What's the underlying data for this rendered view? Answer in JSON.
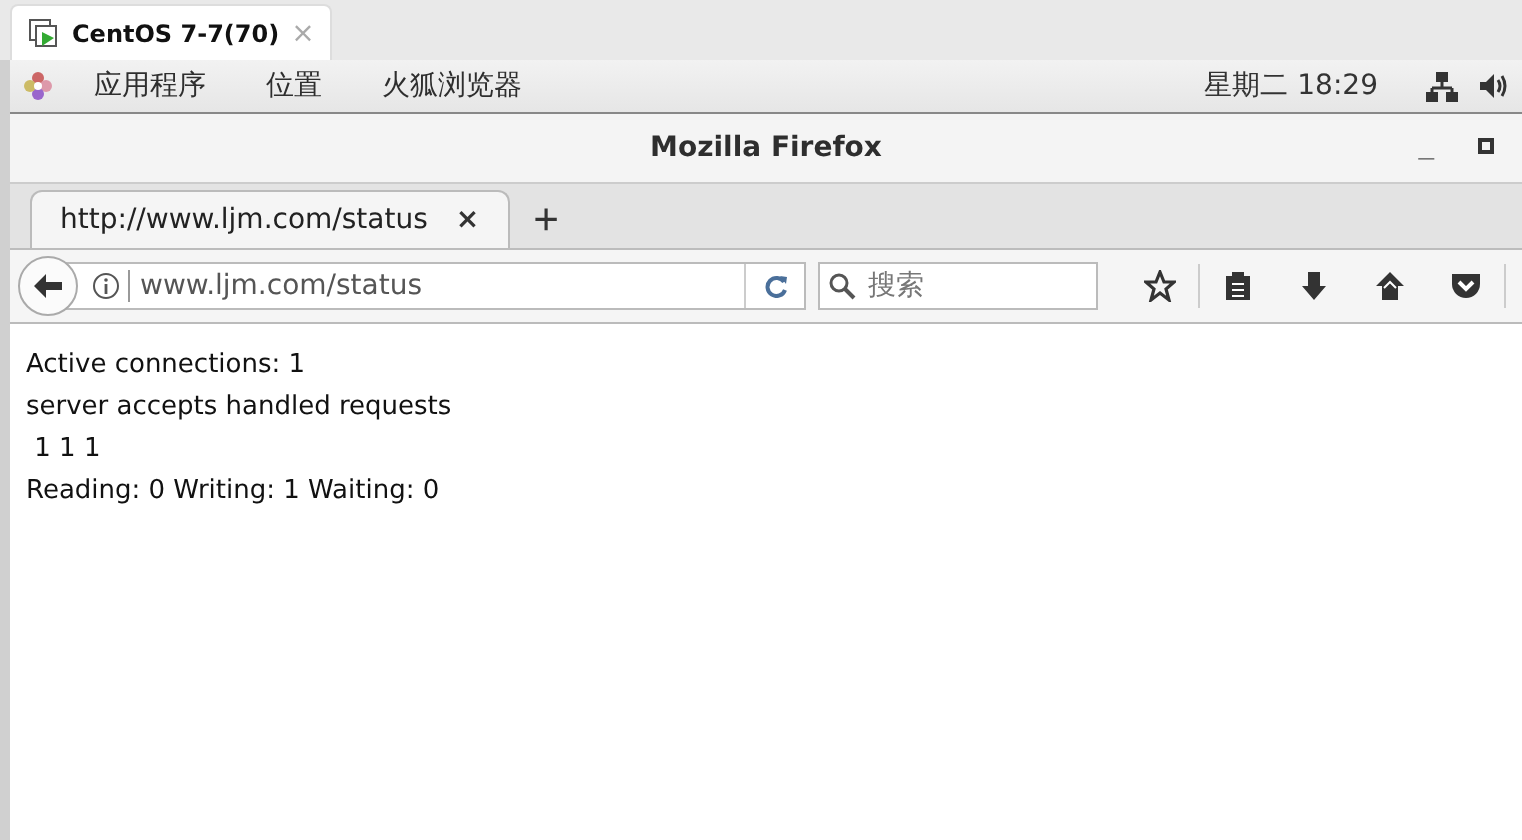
{
  "vm_tab": {
    "title": "CentOS 7-7(70)",
    "close": "×"
  },
  "top_bar": {
    "menus": [
      "应用程序",
      "位置",
      "火狐浏览器"
    ],
    "clock": "星期二 18:29"
  },
  "window": {
    "title": "Mozilla Firefox",
    "minimize": "_"
  },
  "tabs": [
    {
      "label": "http://www.ljm.com/status",
      "close": "×",
      "selected": true
    }
  ],
  "new_tab": "+",
  "url_bar": {
    "value": "www.ljm.com/status"
  },
  "search": {
    "placeholder": "搜索"
  },
  "page_lines": [
    "Active connections: 1",
    "server accepts handled requests",
    " 1 1 1",
    "Reading: 0 Writing: 1 Waiting: 0"
  ]
}
